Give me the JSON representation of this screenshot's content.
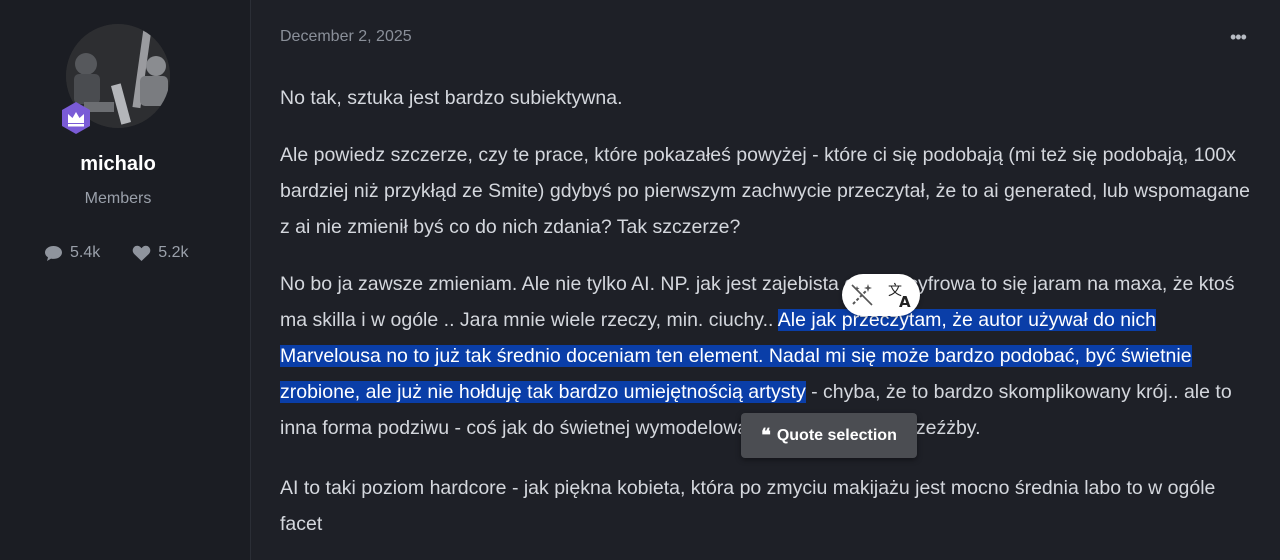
{
  "user": {
    "name": "michalo",
    "group": "Members",
    "stats": [
      {
        "icon": "comment-icon",
        "value": "5.4k"
      },
      {
        "icon": "heart-icon",
        "value": "5.2k"
      }
    ]
  },
  "post": {
    "date": "December 2, 2025",
    "menu_label": "•••",
    "paragraphs": {
      "p1": "No tak, sztuka jest bardzo subiektywna.",
      "p2": "Ale powiedz szczerze, czy te prace, które pokazałeś powyżej - które ci się podobają (mi też się podobają, 100x bardziej niż przykłąd ze Smite) gdybyś po pierwszym zachwycie przeczytał, że to ai generated, lub wspomagane z ai nie zmienił byś co do nich zdania? Tak szczerze?",
      "p3_a": "No bo ja zawsze zmieniam. Ale nie tylko AI. NP. jak jest zajebista grafika cyfrowa to się jaram na maxa, że ktoś ma skilla i w ogóle .. Jara mnie wiele rzeczy, min. ciuchy.. ",
      "p3_selected": "Ale jak przeczytam, że autor używał do nich Marvelousa no to już tak średnio doceniam ten element. Nadal mi się może bardzo podobać, być świetnie zrobione, ale już nie hołduję tak bardzo umiejętnością artysty",
      "p3_b": " - chyba, że to bardzo skomplikowany krój.. ale to inna forma podziwu - coś jak do świetnej wymodelowanej rzeźby, ale nie rzeźżby.",
      "p4": "AI to taki poziom hardcore - jak piękna kobieta, która po zmyciu makijażu jest mocno średnia labo to w ogóle facet"
    }
  },
  "selection_toolbar": {
    "magic_icon": "magic-wand-icon",
    "translate_icon": "translate-icon"
  },
  "quote_button": {
    "glyph": "❝",
    "label": "Quote selection"
  },
  "colors": {
    "background": "#1e2027",
    "sidebar": "#1b1d23",
    "selection": "#0a3ea8",
    "badge": "#7a5bd6"
  }
}
